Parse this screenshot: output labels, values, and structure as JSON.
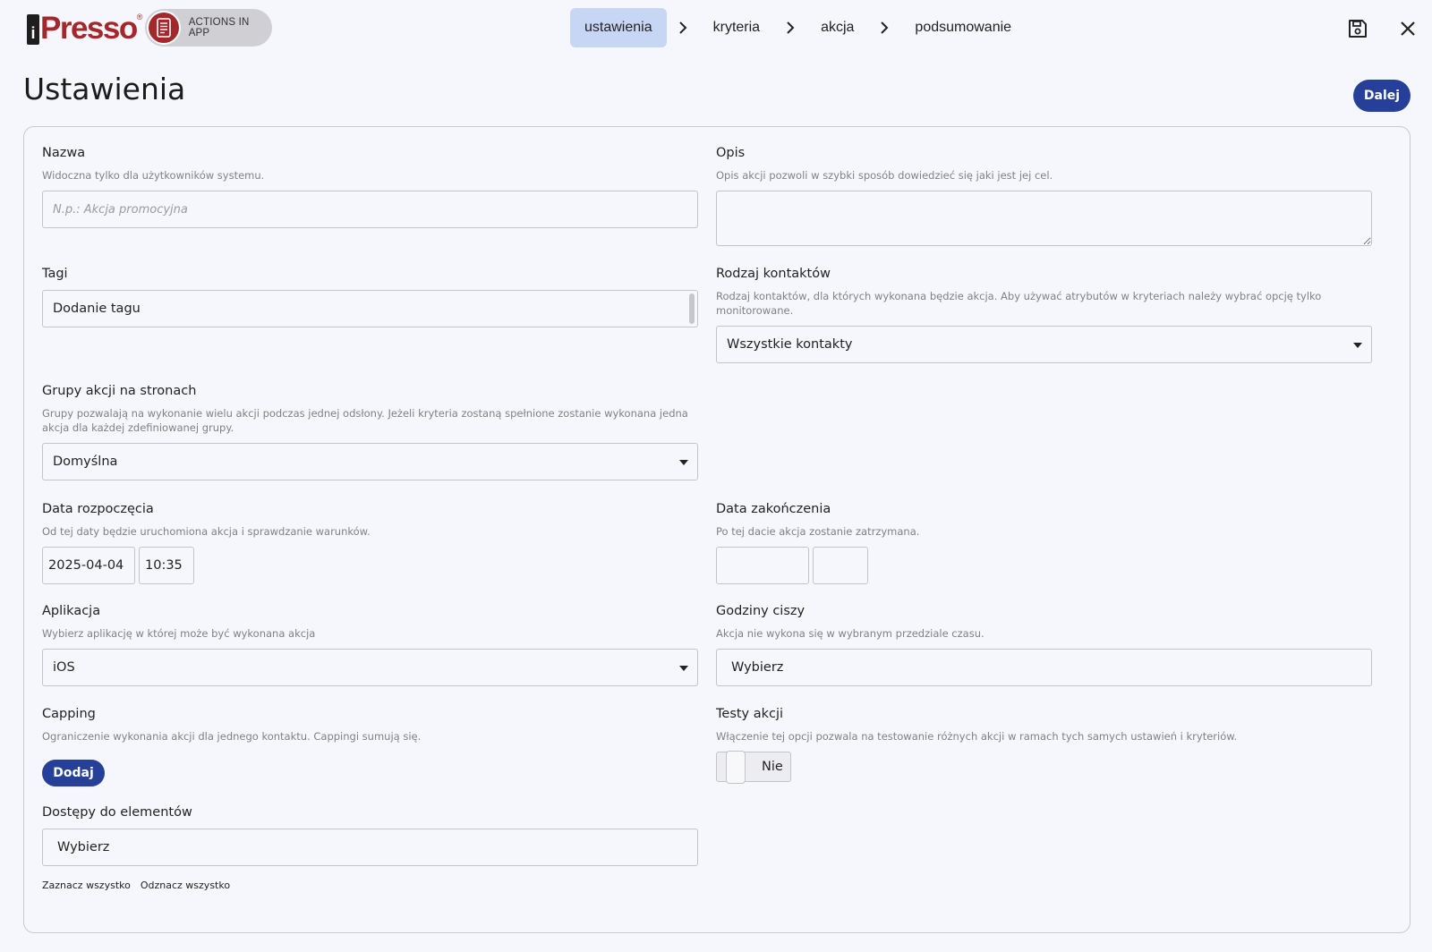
{
  "header": {
    "logo_text": "Presso",
    "logo_initial": "i",
    "logo_registered": "®",
    "module_label": "ACTIONS IN APP",
    "steps": [
      {
        "label": "ustawienia",
        "active": true
      },
      {
        "label": "kryteria",
        "active": false
      },
      {
        "label": "akcja",
        "active": false
      },
      {
        "label": "podsumowanie",
        "active": false
      }
    ],
    "icons": [
      "save-icon",
      "close-icon"
    ]
  },
  "page": {
    "title": "Ustawienia",
    "next_label": "Dalej"
  },
  "form": {
    "name": {
      "label": "Nazwa",
      "hint": "Widoczna tylko dla użytkowników systemu.",
      "placeholder": "N.p.: Akcja promocyjna",
      "value": ""
    },
    "description": {
      "label": "Opis",
      "hint": "Opis akcji pozwoli w szybki sposób dowiedzieć się jaki jest jej cel.",
      "value": ""
    },
    "tags": {
      "label": "Tagi",
      "value": "Dodanie tagu"
    },
    "contact_type": {
      "label": "Rodzaj kontaktów",
      "hint": "Rodzaj kontaktów, dla których wykonana będzie akcja. Aby używać atrybutów w kryteriach należy wybrać opcję tylko monitorowane.",
      "value": "Wszystkie kontakty"
    },
    "groups": {
      "label": "Grupy akcji na stronach",
      "hint": "Grupy pozwalają na wykonanie wielu akcji podczas jednej odsłony. Jeżeli kryteria zostaną spełnione zostanie wykonana jedna akcja dla każdej zdefiniowanej grupy.",
      "value": "Domyślna"
    },
    "start_date": {
      "label": "Data rozpoczęcia",
      "hint": "Od tej daty będzie uruchomiona akcja i sprawdzanie warunków.",
      "date": "2025-04-04",
      "time": "10:35"
    },
    "end_date": {
      "label": "Data zakończenia",
      "hint": "Po tej dacie akcja zostanie zatrzymana.",
      "date": "",
      "time": ""
    },
    "application": {
      "label": "Aplikacja",
      "hint": "Wybierz aplikację w której może być wykonana akcja",
      "value": "iOS"
    },
    "quiet_hours": {
      "label": "Godziny ciszy",
      "hint": "Akcja nie wykona się w wybranym przedziale czasu.",
      "value": "Wybierz"
    },
    "capping": {
      "label": "Capping",
      "hint": "Ograniczenie wykonania akcji dla jednego kontaktu. Cappingi sumują się.",
      "button": "Dodaj"
    },
    "tests": {
      "label": "Testy akcji",
      "hint": "Włączenie tej opcji pozwala na testowanie różnych akcji w ramach tych samych ustawień i kryteriów.",
      "toggle_label": "Nie"
    },
    "access": {
      "label": "Dostępy do elementów",
      "value": "Wybierz",
      "select_all": "Zaznacz wszystko",
      "deselect_all": "Odznacz wszystko"
    }
  },
  "colors": {
    "brand": "#a4272b",
    "primary": "#26409a",
    "active_step": "#c8d6f6",
    "background": "#f6f7fd"
  }
}
